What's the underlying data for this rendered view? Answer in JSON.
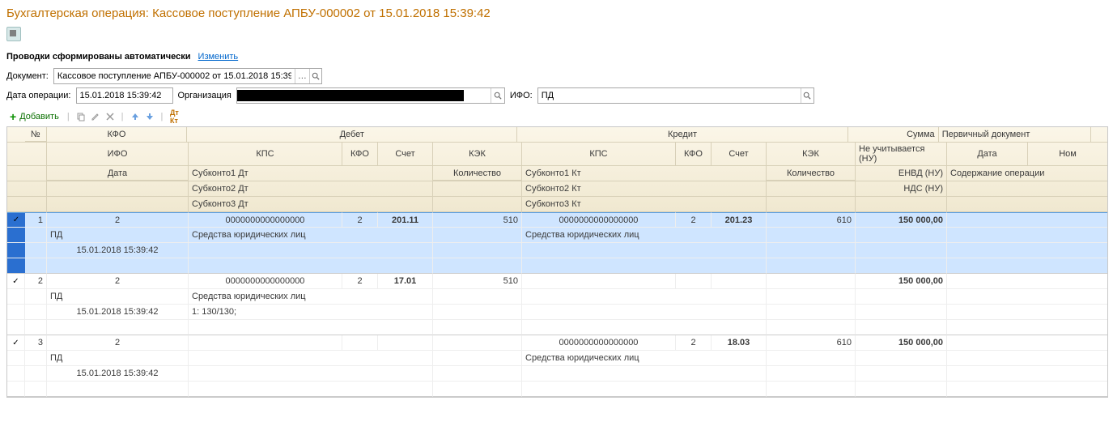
{
  "title": "Бухгалтерская операция: Кассовое поступление АПБУ-000002 от 15.01.2018 15:39:42",
  "autoLine": {
    "text": "Проводки сформированы автоматически",
    "link": "Изменить"
  },
  "form": {
    "docLabel": "Документ:",
    "docValue": "Кассовое поступление АПБУ-000002 от 15.01.2018 15:39:",
    "opDateLabel": "Дата операции:",
    "opDateValue": "15.01.2018 15:39:42",
    "orgLabel": "Организация",
    "ifoLabel": "ИФО:",
    "ifoValue": "ПД"
  },
  "actions": {
    "add": "Добавить"
  },
  "head": {
    "num": "№",
    "kfo": "КФО",
    "ifo": "ИФО",
    "date": "Дата",
    "debit": "Дебет",
    "credit": "Кредит",
    "kps": "КПС",
    "kfoCol": "КФО",
    "account": "Счет",
    "kek": "КЭК",
    "sub1d": "Субконто1 Дт",
    "sub2d": "Субконто2 Дт",
    "sub3d": "Субконто3 Дт",
    "sub1k": "Субконто1 Кт",
    "sub2k": "Субконто2 Кт",
    "sub3k": "Субконто3 Кт",
    "qty": "Количество",
    "sum": "Сумма",
    "nu": "Не учитывается (НУ)",
    "envd": "ЕНВД (НУ)",
    "nds": "НДС (НУ)",
    "primDoc": "Первичный документ",
    "dateH": "Дата",
    "nom": "Ном",
    "content": "Содержание операции"
  },
  "rows": [
    {
      "selected": true,
      "tick": "✓",
      "num": "1",
      "kfo": "2",
      "ifo": "ПД",
      "date": "15.01.2018 15:39:42",
      "dbKps": "0000000000000000",
      "dbKfo": "2",
      "dbAcc": "201.11",
      "dbKek": "510",
      "dbSub1": "Средства юридических лиц",
      "dbSub2": "",
      "dbSub3": "",
      "crKps": "0000000000000000",
      "crKfo": "2",
      "crAcc": "201.23",
      "crKek": "610",
      "crSub1": "Средства юридических лиц",
      "crSub2": "",
      "crSub3": "",
      "sum": "150 000,00"
    },
    {
      "selected": false,
      "tick": "✓",
      "num": "2",
      "kfo": "2",
      "ifo": "ПД",
      "date": "15.01.2018 15:39:42",
      "dbKps": "0000000000000000",
      "dbKfo": "2",
      "dbAcc": "17.01",
      "dbKek": "510",
      "dbSub1": "Средства юридических лиц",
      "dbSub2": "1: 130/130;",
      "dbSub3": "",
      "crKps": "",
      "crKfo": "",
      "crAcc": "",
      "crKek": "",
      "crSub1": "",
      "crSub2": "",
      "crSub3": "",
      "sum": "150 000,00"
    },
    {
      "selected": false,
      "tick": "✓",
      "num": "3",
      "kfo": "2",
      "ifo": "ПД",
      "date": "15.01.2018 15:39:42",
      "dbKps": "",
      "dbKfo": "",
      "dbAcc": "",
      "dbKek": "",
      "dbSub1": "",
      "dbSub2": "",
      "dbSub3": "",
      "crKps": "0000000000000000",
      "crKfo": "2",
      "crAcc": "18.03",
      "crKek": "610",
      "crSub1": "Средства юридических лиц",
      "crSub2": "",
      "crSub3": "",
      "sum": "150 000,00"
    }
  ]
}
